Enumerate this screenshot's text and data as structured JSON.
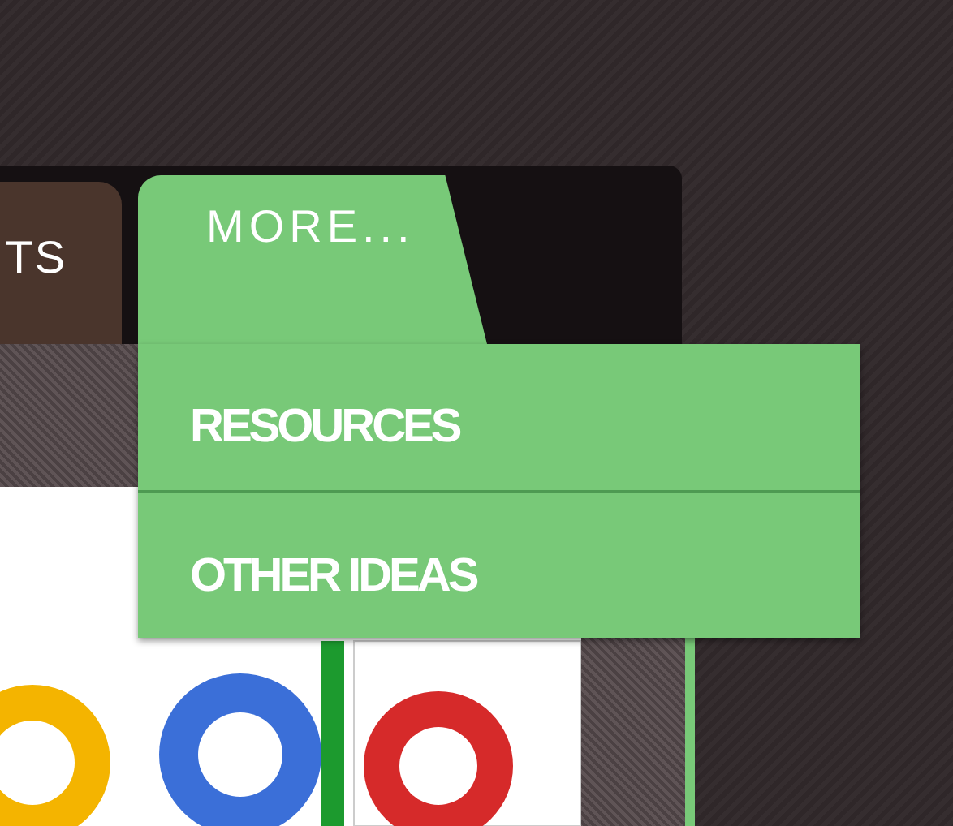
{
  "tabs": [
    {
      "label": "TS",
      "selected": false
    },
    {
      "label": "MORE...",
      "selected": true
    }
  ],
  "menu": {
    "items": [
      {
        "label": "RESOURCES"
      },
      {
        "label": "OTHER IDEAS"
      }
    ]
  }
}
